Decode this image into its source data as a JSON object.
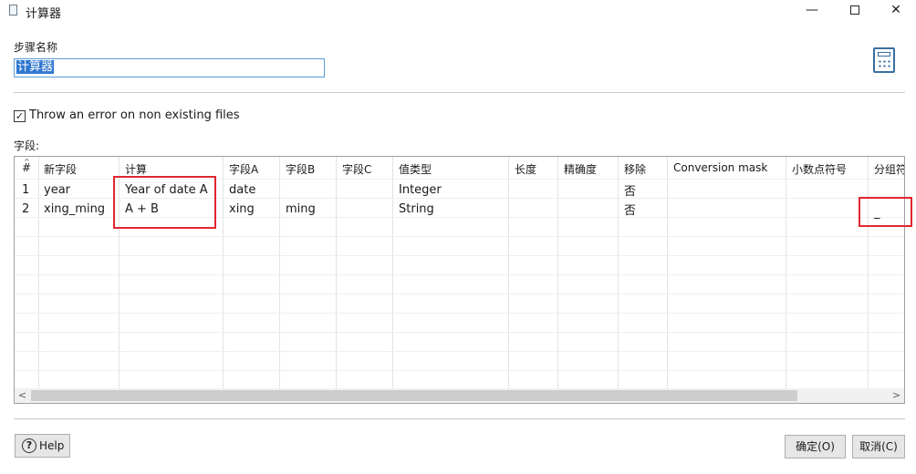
{
  "window": {
    "title": "计算器",
    "minimize_glyph": "—",
    "close_glyph": "✕"
  },
  "step": {
    "label": "步骤名称",
    "value": "计算器",
    "icon": "calculator-icon"
  },
  "options": {
    "throw_error_label": "Throw an error on non existing files",
    "throw_error_checked": true,
    "check_glyph": "✓"
  },
  "fields": {
    "label": "字段:",
    "columns": [
      "#",
      "新字段",
      "计算",
      "字段A",
      "字段B",
      "字段C",
      "值类型",
      "长度",
      "精确度",
      "移除",
      "Conversion mask",
      "小数点符号",
      "分组符"
    ],
    "rows": [
      [
        "1",
        "year",
        "Year of date A",
        "date",
        "",
        "",
        "Integer",
        "",
        "",
        "否",
        "",
        "",
        ""
      ],
      [
        "2",
        "xing_ming",
        "A + B",
        "xing",
        "ming",
        "",
        "String",
        "",
        "",
        "否",
        "",
        "",
        "_"
      ]
    ],
    "scroll_left": "<",
    "scroll_right": ">"
  },
  "buttons": {
    "help": "Help",
    "help_icon_glyph": "?",
    "ok": "确定(O)",
    "cancel": "取消(C)"
  },
  "colors": {
    "highlight_box": "#e0262f",
    "selection": "#3077d1"
  }
}
